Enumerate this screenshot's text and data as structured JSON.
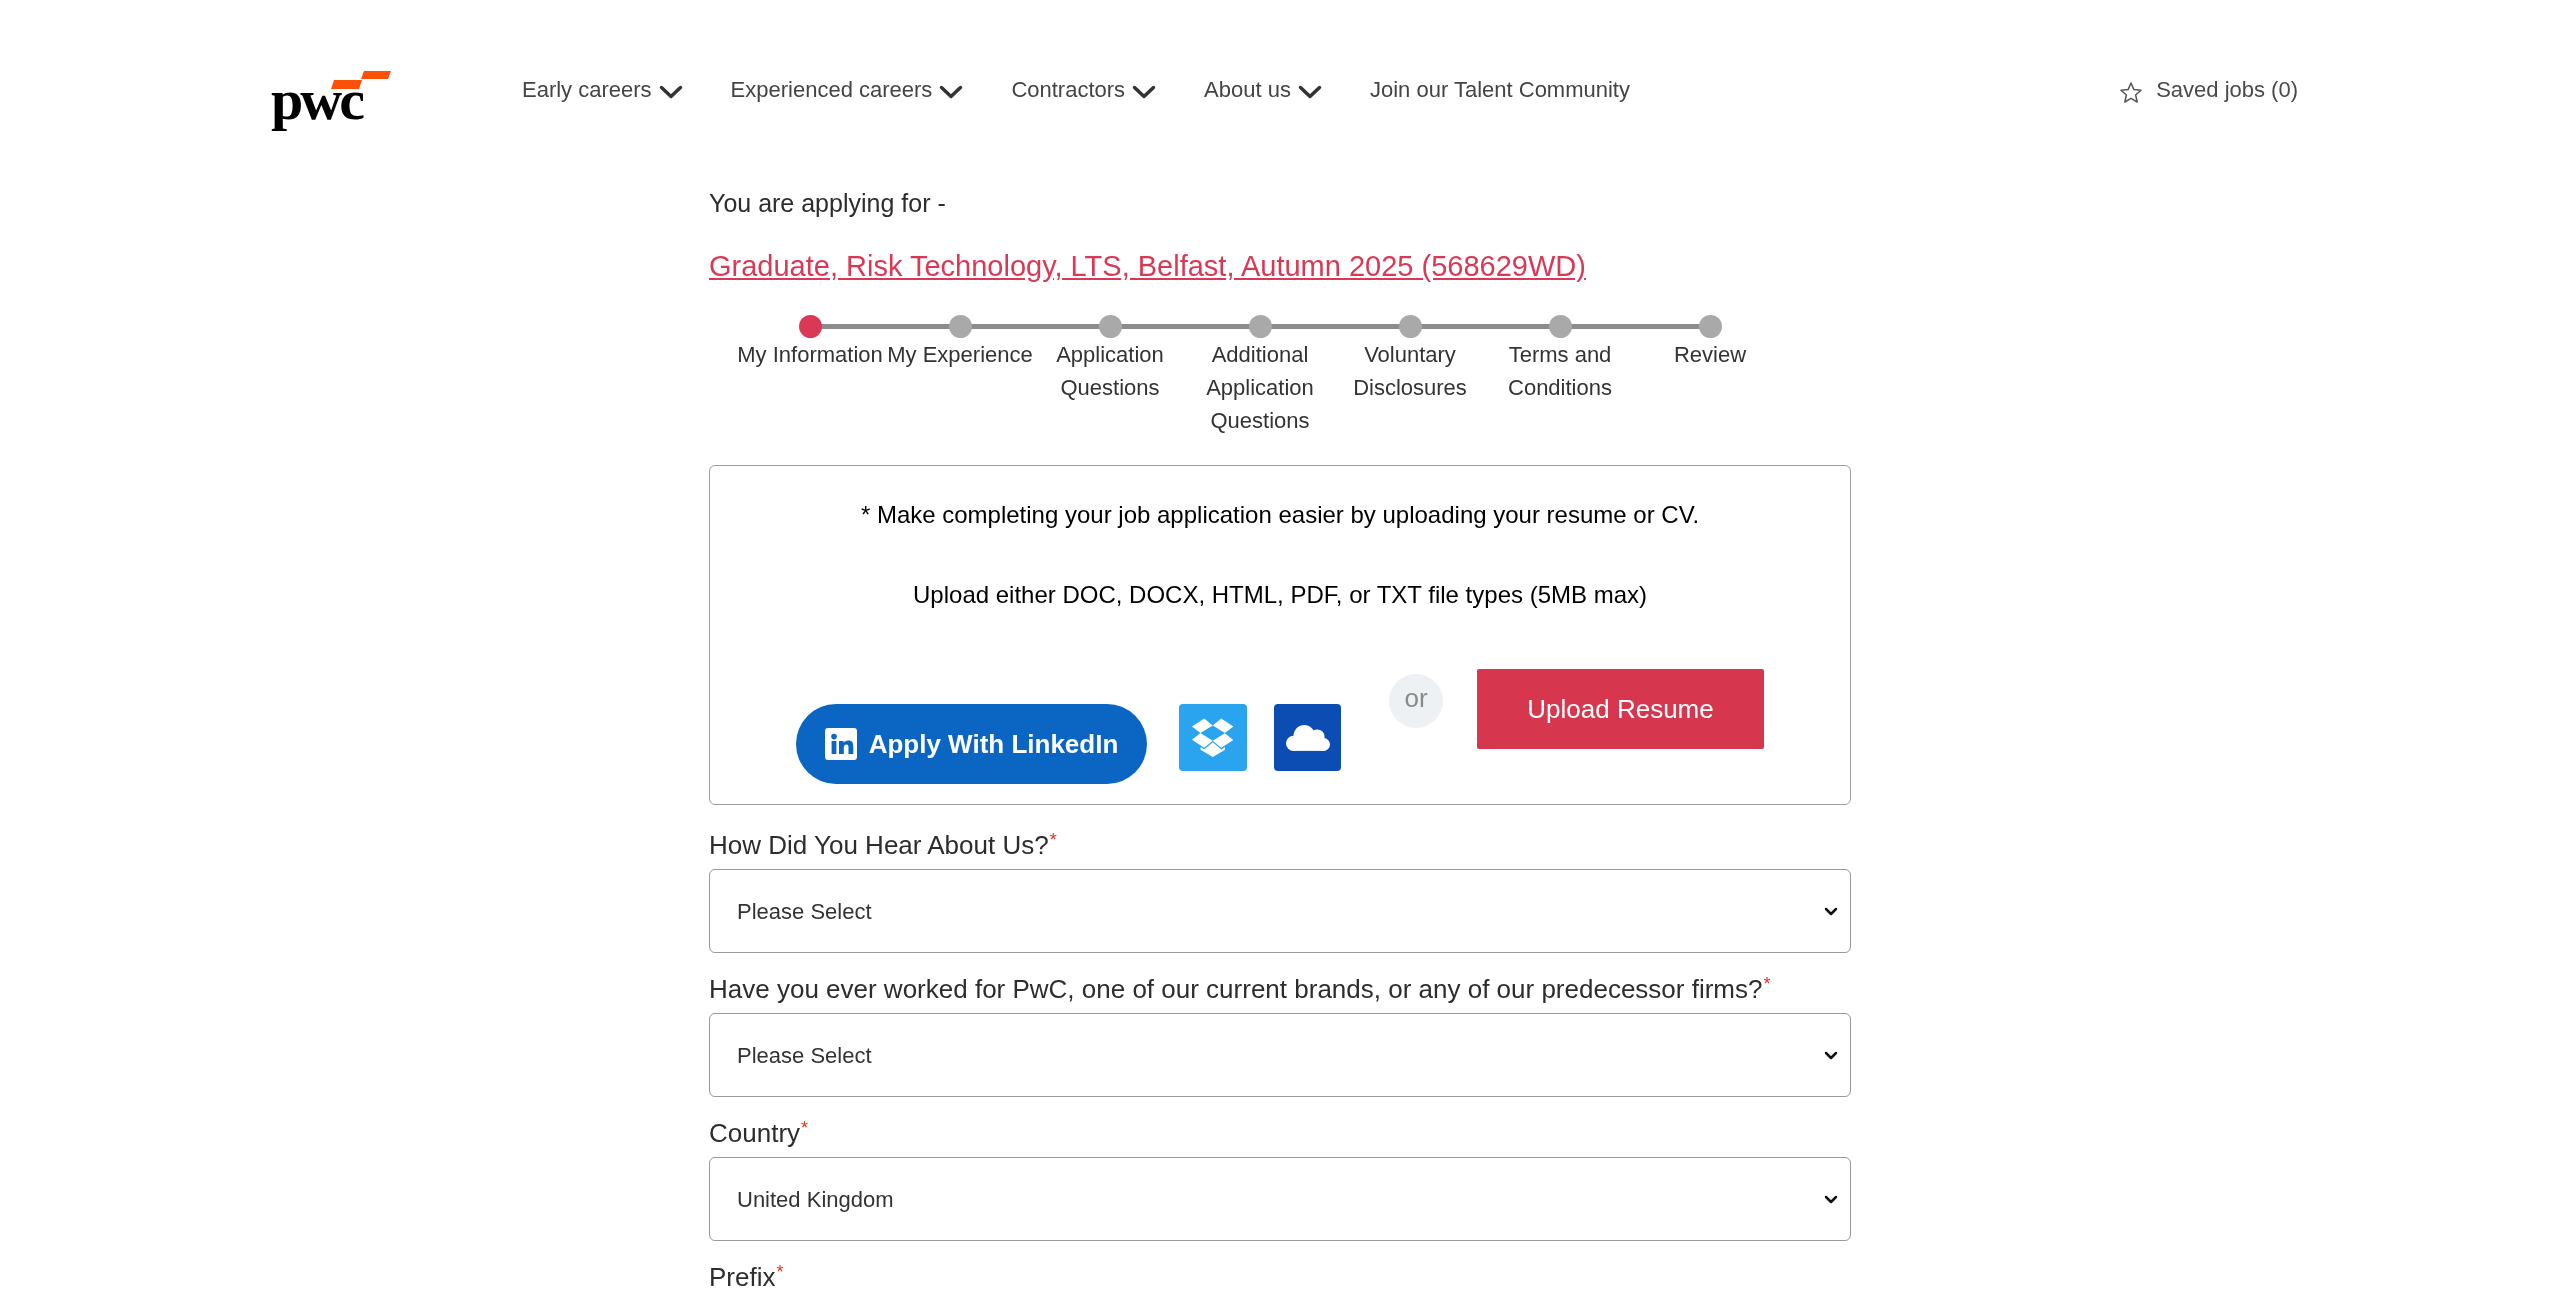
{
  "header": {
    "logo": "pwc",
    "nav": [
      {
        "kind": "dropdown",
        "label": "Early careers"
      },
      {
        "kind": "dropdown",
        "label": "Experienced careers"
      },
      {
        "kind": "dropdown",
        "label": "Contractors"
      },
      {
        "kind": "dropdown",
        "label": "About us"
      },
      {
        "kind": "link",
        "label": "Join our Talent Community"
      }
    ],
    "saved_jobs": "Saved jobs (0)"
  },
  "application": {
    "intro": "You are applying for -",
    "job_title": "Graduate, Risk Technology, LTS, Belfast, Autumn 2025 (568629WD)"
  },
  "steps": [
    {
      "label": "My Information",
      "selected": true
    },
    {
      "label": "My Experience",
      "selected": false
    },
    {
      "label": "Application Questions",
      "selected": false
    },
    {
      "label": "Additional Application Questions",
      "selected": false
    },
    {
      "label": "Voluntary Disclosures",
      "selected": false
    },
    {
      "label": "Terms and Conditions",
      "selected": false
    },
    {
      "label": "Review",
      "selected": false
    }
  ],
  "resume_upload": {
    "prompt": "* Make completing your job application easier by uploading your resume or CV.",
    "file_types": "Upload either DOC, DOCX, HTML, PDF, or TXT file types (5MB max)",
    "linkedin_button": "Apply With LinkedIn",
    "separator": "or",
    "upload_button": "Upload Resume"
  },
  "fields": [
    {
      "label": "How Did You Hear About Us?",
      "required_mark": "*",
      "value": "Please Select"
    },
    {
      "label": "Have you ever worked for PwC, one of our current brands, or any of our predecessor firms?",
      "required_mark": "*",
      "value": "Please Select"
    },
    {
      "label": "Country",
      "required_mark": "*",
      "value": "United Kingdom"
    },
    {
      "label": "Prefix",
      "required_mark": "*"
    }
  ]
}
